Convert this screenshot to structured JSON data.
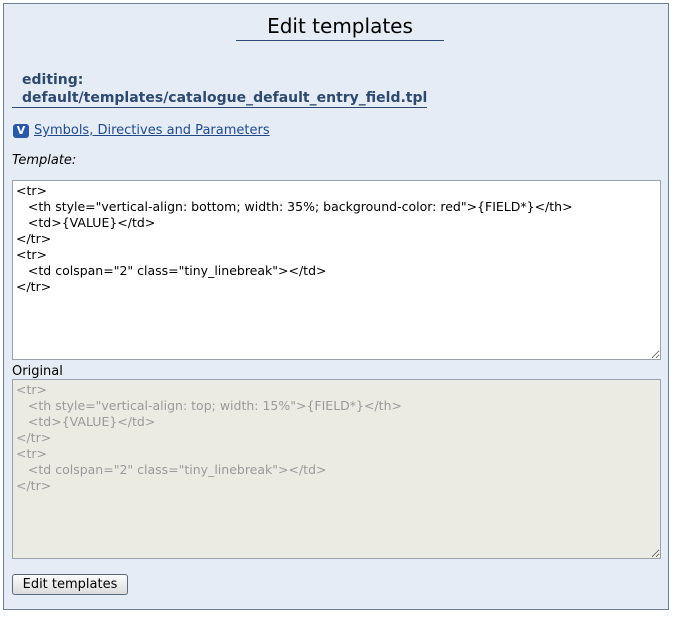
{
  "page": {
    "title": "Edit templates"
  },
  "editing": {
    "label": "editing:",
    "path": "default/templates/catalogue_default_entry_field.tpl"
  },
  "help": {
    "icon": "chevron-down-icon",
    "icon_glyph": "V",
    "link_text": "Symbols, Directives and Parameters"
  },
  "template_field": {
    "label": "Template:",
    "value": "<tr>\n   <th style=\"vertical-align: bottom; width: 35%; background-color: red\">{FIELD*}</th>\n   <td>{VALUE}</td>\n</tr>\n<tr>\n   <td colspan=\"2\" class=\"tiny_linebreak\"></td>\n</tr>"
  },
  "original_field": {
    "label": "Original",
    "value": "<tr>\n   <th style=\"vertical-align: top; width: 15%\">{FIELD*}</th>\n   <td>{VALUE}</td>\n</tr>\n<tr>\n   <td colspan=\"2\" class=\"tiny_linebreak\"></td>\n</tr>"
  },
  "actions": {
    "submit_label": "Edit templates"
  },
  "colors": {
    "panel_background": "#e6ecf5",
    "accent": "#2d4a6e",
    "original_background": "#ebeae3"
  }
}
